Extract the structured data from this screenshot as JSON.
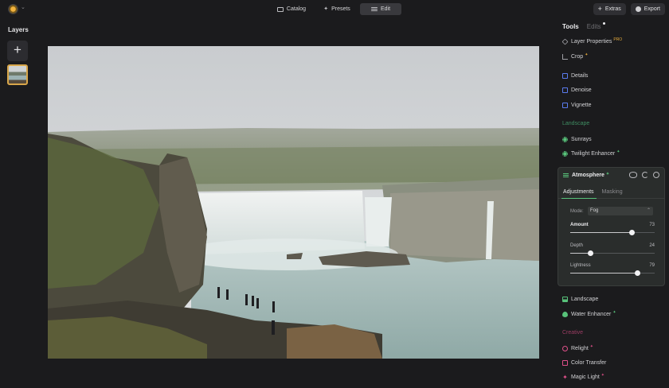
{
  "topbar": {
    "catalog_label": "Catalog",
    "presets_label": "Presets",
    "edit_label": "Edit",
    "extras_label": "Extras",
    "export_label": "Export"
  },
  "layers": {
    "title": "Layers"
  },
  "panel": {
    "tab_tools": "Tools",
    "tab_edits": "Edits",
    "layer_properties": "Layer Properties",
    "crop": "Crop",
    "details": "Details",
    "denoise": "Denoise",
    "vignette": "Vignette",
    "section_landscape": "Landscape",
    "sunrays": "Sunrays",
    "twilight_enhancer": "Twilight Enhancer",
    "landscape": "Landscape",
    "water_enhancer": "Water Enhancer",
    "section_creative": "Creative",
    "relight": "Relight",
    "color_transfer": "Color Transfer",
    "magic_light": "Magic Light"
  },
  "atmosphere": {
    "title": "Atmosphere",
    "tab_adjustments": "Adjustments",
    "tab_masking": "Masking",
    "mode_label": "Mode:",
    "mode_value": "Fog",
    "amount_label": "Amount",
    "amount_value": "73",
    "amount_fraction": 0.73,
    "depth_label": "Depth",
    "depth_value": "24",
    "depth_fraction": 0.24,
    "lightness_label": "Lightness",
    "lightness_value": "79",
    "lightness_fraction": 0.79
  },
  "colors": {
    "accent_green": "#58c27a",
    "accent_pink": "#e0508a",
    "accent_blue": "#5b7cf0",
    "pro_badge": "#e3a93c"
  }
}
